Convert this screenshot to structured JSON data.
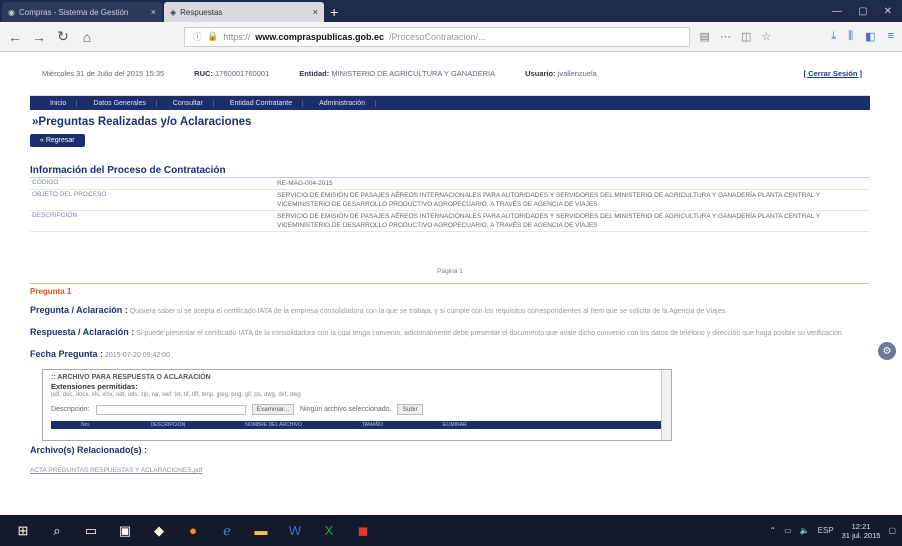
{
  "browser": {
    "tabs": [
      {
        "title": "Compras - Sistema de Gestión",
        "close": "×"
      },
      {
        "title": "Respuestas",
        "close": "×"
      }
    ],
    "new_tab": "+",
    "url_domain": "www.compraspublicas.gob.ec",
    "url_prefix": "https://",
    "url_path": "/ProcesoContratacion/..."
  },
  "userbar": {
    "date": "Miércoles 31 de Julio del 2015 15:35",
    "ruc_label": "RUC:",
    "ruc": "1760001760001",
    "entity_label": "Entidad:",
    "entity": "MINISTERIO DE AGRICULTURA Y GANADERIA",
    "user_label": "Usuario:",
    "user": "jvallenzuela",
    "logout": "[ Cerrar Sesión ]"
  },
  "menu": [
    "Inicio",
    "Datos Generales",
    "Consultar",
    "Entidad Contratante",
    "Administración"
  ],
  "page_title": "»Preguntas Realizadas y/o Aclaraciones",
  "back_button": "Regresar",
  "info": {
    "title": "Información del Proceso de Contratación",
    "rows": [
      {
        "key": "CÓDIGO",
        "value": "RE-MAG-004-2015"
      },
      {
        "key": "OBJETO DEL PROCESO",
        "value": "SERVICIO DE EMISIÓN DE PASAJES AÉREOS INTERNACIONALES PARA AUTORIDADES Y SERVIDORES DEL MINISTERIO DE AGRICULTURA Y GANADERÍA PLANTA CENTRAL Y VICEMINISTERIO DE DESARROLLO PRODUCTIVO AGROPECUARIO, A TRAVÉS DE AGENCIA DE VIAJES"
      },
      {
        "key": "DESCRIPCIÓN",
        "value": "SERVICIO DE EMISIÓN DE PASAJES AÉREOS INTERNACIONALES PARA AUTORIDADES Y SERVIDORES DEL MINISTERIO DE AGRICULTURA Y GANADERÍA PLANTA CENTRAL Y VICEMINISTERIO DE DESARROLLO PRODUCTIVO AGROPECUARIO, A TRAVÉS DE AGENCIA DE VIAJES"
      }
    ]
  },
  "pagination": "Página 1",
  "question": {
    "header": "Pregunta 1",
    "q_label": "Pregunta / Aclaración :",
    "q_text": "Quisiera saber si se acepta el certificado IATA de la empresa consolidadora con la que se trabaja, y si cumple con los requisitos correspondientes al ítem que se solicita de la Agencia de Viajes.",
    "a_label": "Respuesta / Aclaración :",
    "a_text": "Si puede presentar el certificado IATA de la consolidadora con la cual tenga convenio, adicionalmente debe presentar el documento que avale dicho convenio con los datos de teléfono y dirección que haga posible su verificación.",
    "date_label": "Fecha Pregunta :",
    "date": "2015-07-20 09:42:00"
  },
  "upload": {
    "title": ":: ARCHIVO PARA RESPUESTA O ACLARACIÓN",
    "ext_label": "Extensiones permitidas:",
    "ext": "pdf, doc, docx, xls, xlsx, odt, ods, zip, rar, swf, txt, tif, tiff, bmp, jpeg, png, gif, ps, dwg, dxf, dwg",
    "desc_label": "Descripción:",
    "browse": "Examinar...",
    "no_file": "Ningún archivo seleccionado.",
    "submit": "Subir",
    "cols": [
      "Nro.",
      "DESCRIPCIÓN",
      "NOMBRE DEL ARCHIVO",
      "TAMAÑO",
      "ELIMINAR"
    ]
  },
  "related_label": "Archivo(s) Relacionado(s) :",
  "related_link": "ACTA PREGUNTAS RESPUESTAS Y ACLARACIONES.pdf",
  "taskbar": {
    "lang": "ESP",
    "time": "12:21",
    "date": "31 jul. 2015"
  }
}
